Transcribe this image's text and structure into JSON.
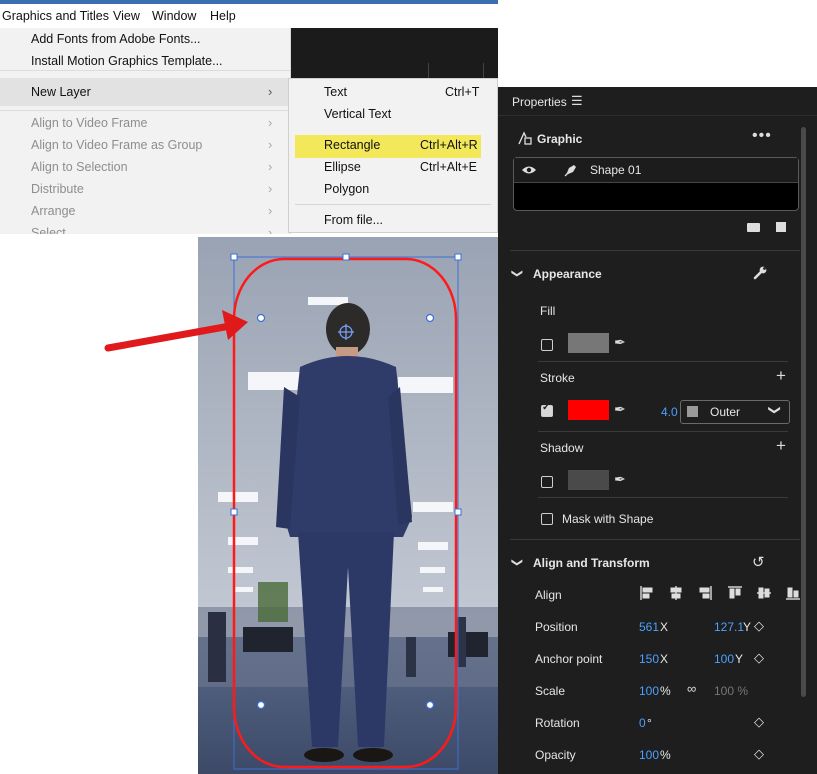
{
  "menubar": {
    "items": [
      "Graphics and Titles",
      "View",
      "Window",
      "Help"
    ]
  },
  "menu": {
    "items": [
      {
        "label": "Add Fonts from Adobe Fonts...",
        "enabled": true
      },
      {
        "label": "Install Motion Graphics Template...",
        "enabled": true
      },
      {
        "label": "New Layer",
        "enabled": true,
        "submenu": true
      },
      {
        "label": "Align to Video Frame",
        "enabled": false,
        "submenu": true
      },
      {
        "label": "Align to Video Frame as Group",
        "enabled": false,
        "submenu": true
      },
      {
        "label": "Align to Selection",
        "enabled": false,
        "submenu": true
      },
      {
        "label": "Distribute",
        "enabled": false,
        "submenu": true
      },
      {
        "label": "Arrange",
        "enabled": false,
        "submenu": true
      },
      {
        "label": "Select",
        "enabled": false,
        "submenu": true
      }
    ]
  },
  "submenu": {
    "items": [
      {
        "label": "Text",
        "shortcut": "Ctrl+T"
      },
      {
        "label": "Vertical Text",
        "shortcut": ""
      },
      {
        "label": "Rectangle",
        "shortcut": "Ctrl+Alt+R",
        "highlighted": true
      },
      {
        "label": "Ellipse",
        "shortcut": "Ctrl+Alt+E"
      },
      {
        "label": "Polygon",
        "shortcut": ""
      },
      {
        "label": "From file...",
        "shortcut": ""
      }
    ]
  },
  "colors": {
    "highlight": "#f2e85a",
    "accent_blue": "#4aa1ff",
    "stroke_red": "#ff0000",
    "annotation_arrow": "#e0191b",
    "panel_bg": "#1e1e1e",
    "fill_swatch": "#777777",
    "shadow_swatch": "#4a4a4a"
  },
  "properties": {
    "title": "Properties",
    "menu_icon": "hamburger-icon",
    "graphic": {
      "label": "Graphic",
      "more_icon": "more-icon"
    },
    "layer": {
      "name": "Shape 01",
      "visibility_icon": "eye-icon",
      "type_icon": "pen-icon"
    },
    "appearance": {
      "title": "Appearance",
      "fill": {
        "label": "Fill",
        "checked": false
      },
      "stroke": {
        "label": "Stroke",
        "checked": true,
        "width": "4.0",
        "position": "Outer"
      },
      "shadow": {
        "label": "Shadow",
        "checked": false
      },
      "mask": {
        "label": "Mask with Shape",
        "checked": false
      }
    },
    "align_transform": {
      "title": "Align and Transform",
      "align_label": "Align",
      "position": {
        "label": "Position",
        "x": "561",
        "x_axis": "X",
        "y": "127.1",
        "y_axis": "Y"
      },
      "anchor": {
        "label": "Anchor point",
        "x": "150",
        "x_axis": "X",
        "y": "100",
        "y_axis": "Y"
      },
      "scale": {
        "label": "Scale",
        "value": "100",
        "unit": "%",
        "value2": "100 %"
      },
      "rotation": {
        "label": "Rotation",
        "value": "0",
        "unit": "°"
      },
      "opacity": {
        "label": "Opacity",
        "value": "100",
        "unit": "%"
      }
    }
  }
}
